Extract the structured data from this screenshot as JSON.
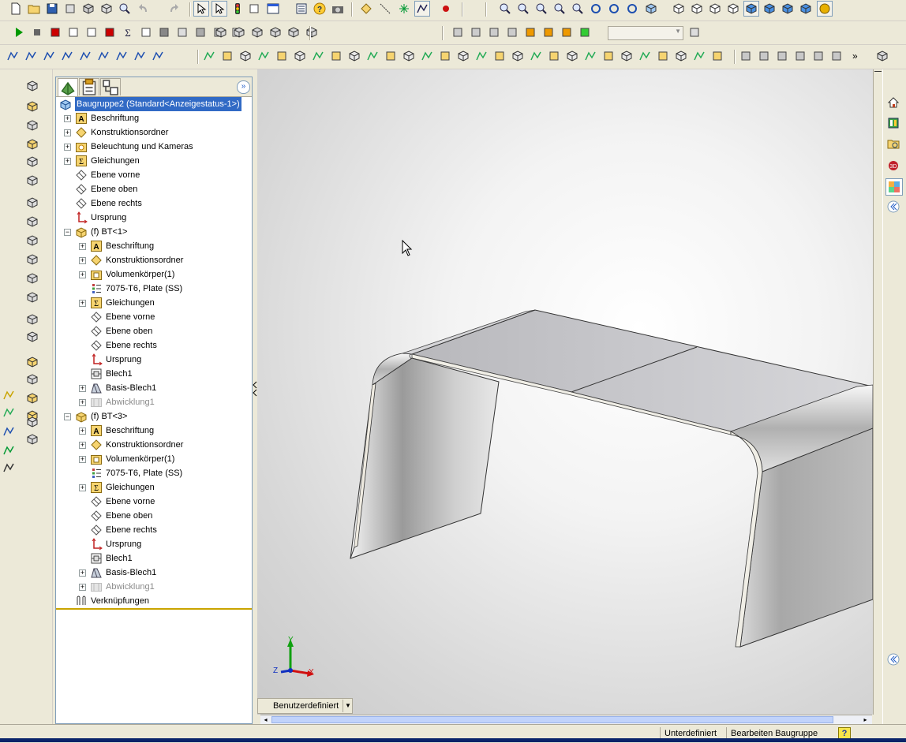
{
  "feature_tabs": [
    "FeatureManager",
    "PropertyManager",
    "ConfigurationManager"
  ],
  "tree": [
    {
      "label": "Baugruppe2  (Standard<Anzeigestatus-1>)",
      "depth": 0,
      "icon": "assembly-icon",
      "expand": "",
      "selected": true,
      "greyed": false
    },
    {
      "label": "Beschriftung",
      "depth": 1,
      "icon": "annotation-icon",
      "expand": "+",
      "selected": false,
      "greyed": false
    },
    {
      "label": "Konstruktionsordner",
      "depth": 1,
      "icon": "design-folder-icon",
      "expand": "+",
      "selected": false,
      "greyed": false
    },
    {
      "label": "Beleuchtung und Kameras",
      "depth": 1,
      "icon": "lights-cameras-icon",
      "expand": "+",
      "selected": false,
      "greyed": false
    },
    {
      "label": "Gleichungen",
      "depth": 1,
      "icon": "equations-icon",
      "expand": "+",
      "selected": false,
      "greyed": false
    },
    {
      "label": "Ebene vorne",
      "depth": 1,
      "icon": "plane-icon",
      "expand": "",
      "selected": false,
      "greyed": false
    },
    {
      "label": "Ebene oben",
      "depth": 1,
      "icon": "plane-icon",
      "expand": "",
      "selected": false,
      "greyed": false
    },
    {
      "label": "Ebene rechts",
      "depth": 1,
      "icon": "plane-icon",
      "expand": "",
      "selected": false,
      "greyed": false
    },
    {
      "label": "Ursprung",
      "depth": 1,
      "icon": "origin-icon",
      "expand": "",
      "selected": false,
      "greyed": false
    },
    {
      "label": "(f) BT<1>",
      "depth": 1,
      "icon": "part-icon",
      "expand": "-",
      "selected": false,
      "greyed": false
    },
    {
      "label": "Beschriftung",
      "depth": 2,
      "icon": "annotation-icon",
      "expand": "+",
      "selected": false,
      "greyed": false
    },
    {
      "label": "Konstruktionsordner",
      "depth": 2,
      "icon": "design-folder-icon",
      "expand": "+",
      "selected": false,
      "greyed": false
    },
    {
      "label": "Volumenkörper(1)",
      "depth": 2,
      "icon": "solid-bodies-icon",
      "expand": "+",
      "selected": false,
      "greyed": false
    },
    {
      "label": "7075-T6, Plate (SS)",
      "depth": 2,
      "icon": "material-icon",
      "expand": "",
      "selected": false,
      "greyed": false
    },
    {
      "label": "Gleichungen",
      "depth": 2,
      "icon": "equations-icon",
      "expand": "+",
      "selected": false,
      "greyed": false
    },
    {
      "label": "Ebene vorne",
      "depth": 2,
      "icon": "plane-icon",
      "expand": "",
      "selected": false,
      "greyed": false
    },
    {
      "label": "Ebene oben",
      "depth": 2,
      "icon": "plane-icon",
      "expand": "",
      "selected": false,
      "greyed": false
    },
    {
      "label": "Ebene rechts",
      "depth": 2,
      "icon": "plane-icon",
      "expand": "",
      "selected": false,
      "greyed": false
    },
    {
      "label": "Ursprung",
      "depth": 2,
      "icon": "origin-icon",
      "expand": "",
      "selected": false,
      "greyed": false
    },
    {
      "label": "Blech1",
      "depth": 2,
      "icon": "sheetmetal-icon",
      "expand": "",
      "selected": false,
      "greyed": false
    },
    {
      "label": "Basis-Blech1",
      "depth": 2,
      "icon": "base-flange-icon",
      "expand": "+",
      "selected": false,
      "greyed": false
    },
    {
      "label": "Abwicklung1",
      "depth": 2,
      "icon": "flat-pattern-icon",
      "expand": "+",
      "selected": false,
      "greyed": true
    },
    {
      "label": "(f) BT<3>",
      "depth": 1,
      "icon": "part-icon",
      "expand": "-",
      "selected": false,
      "greyed": false
    },
    {
      "label": "Beschriftung",
      "depth": 2,
      "icon": "annotation-icon",
      "expand": "+",
      "selected": false,
      "greyed": false
    },
    {
      "label": "Konstruktionsordner",
      "depth": 2,
      "icon": "design-folder-icon",
      "expand": "+",
      "selected": false,
      "greyed": false
    },
    {
      "label": "Volumenkörper(1)",
      "depth": 2,
      "icon": "solid-bodies-icon",
      "expand": "+",
      "selected": false,
      "greyed": false
    },
    {
      "label": "7075-T6, Plate (SS)",
      "depth": 2,
      "icon": "material-icon",
      "expand": "",
      "selected": false,
      "greyed": false
    },
    {
      "label": "Gleichungen",
      "depth": 2,
      "icon": "equations-icon",
      "expand": "+",
      "selected": false,
      "greyed": false
    },
    {
      "label": "Ebene vorne",
      "depth": 2,
      "icon": "plane-icon",
      "expand": "",
      "selected": false,
      "greyed": false
    },
    {
      "label": "Ebene oben",
      "depth": 2,
      "icon": "plane-icon",
      "expand": "",
      "selected": false,
      "greyed": false
    },
    {
      "label": "Ebene rechts",
      "depth": 2,
      "icon": "plane-icon",
      "expand": "",
      "selected": false,
      "greyed": false
    },
    {
      "label": "Ursprung",
      "depth": 2,
      "icon": "origin-icon",
      "expand": "",
      "selected": false,
      "greyed": false
    },
    {
      "label": "Blech1",
      "depth": 2,
      "icon": "sheetmetal-icon",
      "expand": "",
      "selected": false,
      "greyed": false
    },
    {
      "label": "Basis-Blech1",
      "depth": 2,
      "icon": "base-flange-icon",
      "expand": "+",
      "selected": false,
      "greyed": false
    },
    {
      "label": "Abwicklung1",
      "depth": 2,
      "icon": "flat-pattern-icon",
      "expand": "+",
      "selected": false,
      "greyed": true
    },
    {
      "label": "Verknüpfungen",
      "depth": 1,
      "icon": "mates-icon",
      "expand": "",
      "selected": false,
      "greyed": false
    }
  ],
  "viewport": {
    "view_orientation": "Benutzerdefiniert",
    "triad": {
      "x": "X",
      "y": "Y",
      "z": "Z"
    }
  },
  "status": {
    "definition": "Unterdefiniert",
    "mode": "Bearbeiten Baugruppe",
    "help": "?"
  },
  "colors": {
    "selection": "#316ac5",
    "chrome": "#ece9d8",
    "title_blue": "#0a246a",
    "axis_x": "#d01010",
    "axis_y": "#10a010",
    "axis_z": "#1030c0"
  }
}
